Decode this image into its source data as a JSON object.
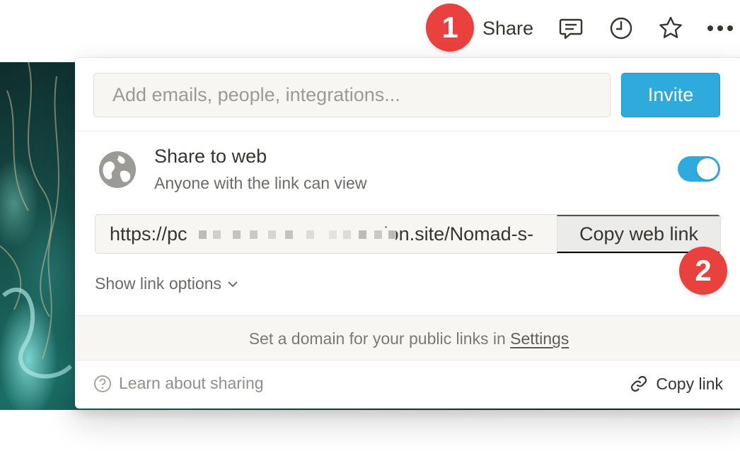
{
  "topbar": {
    "share_label": "Share",
    "icons": [
      "comment-icon",
      "history-clock-icon",
      "star-icon",
      "more-dots-icon"
    ]
  },
  "annotations": {
    "badge_1": "1",
    "badge_2": "2",
    "badge_color": "#e8413e"
  },
  "invite": {
    "placeholder": "Add emails, people, integrations...",
    "button_label": "Invite"
  },
  "share_to_web": {
    "title": "Share to web",
    "subtitle": "Anyone with the link can view",
    "enabled": true,
    "url_start": "https://pc",
    "url_end": "ion.site/Nomad-s-",
    "copy_web_link_label": "Copy web link"
  },
  "link_options": {
    "label": "Show link options"
  },
  "domain": {
    "text_before": "Set a domain for your public links in ",
    "settings_link": "Settings"
  },
  "footer": {
    "learn_label": "Learn about sharing",
    "copy_link_label": "Copy link"
  },
  "colors": {
    "accent": "#2eaadc",
    "text": "#37352f",
    "muted": "#6b6a67"
  }
}
